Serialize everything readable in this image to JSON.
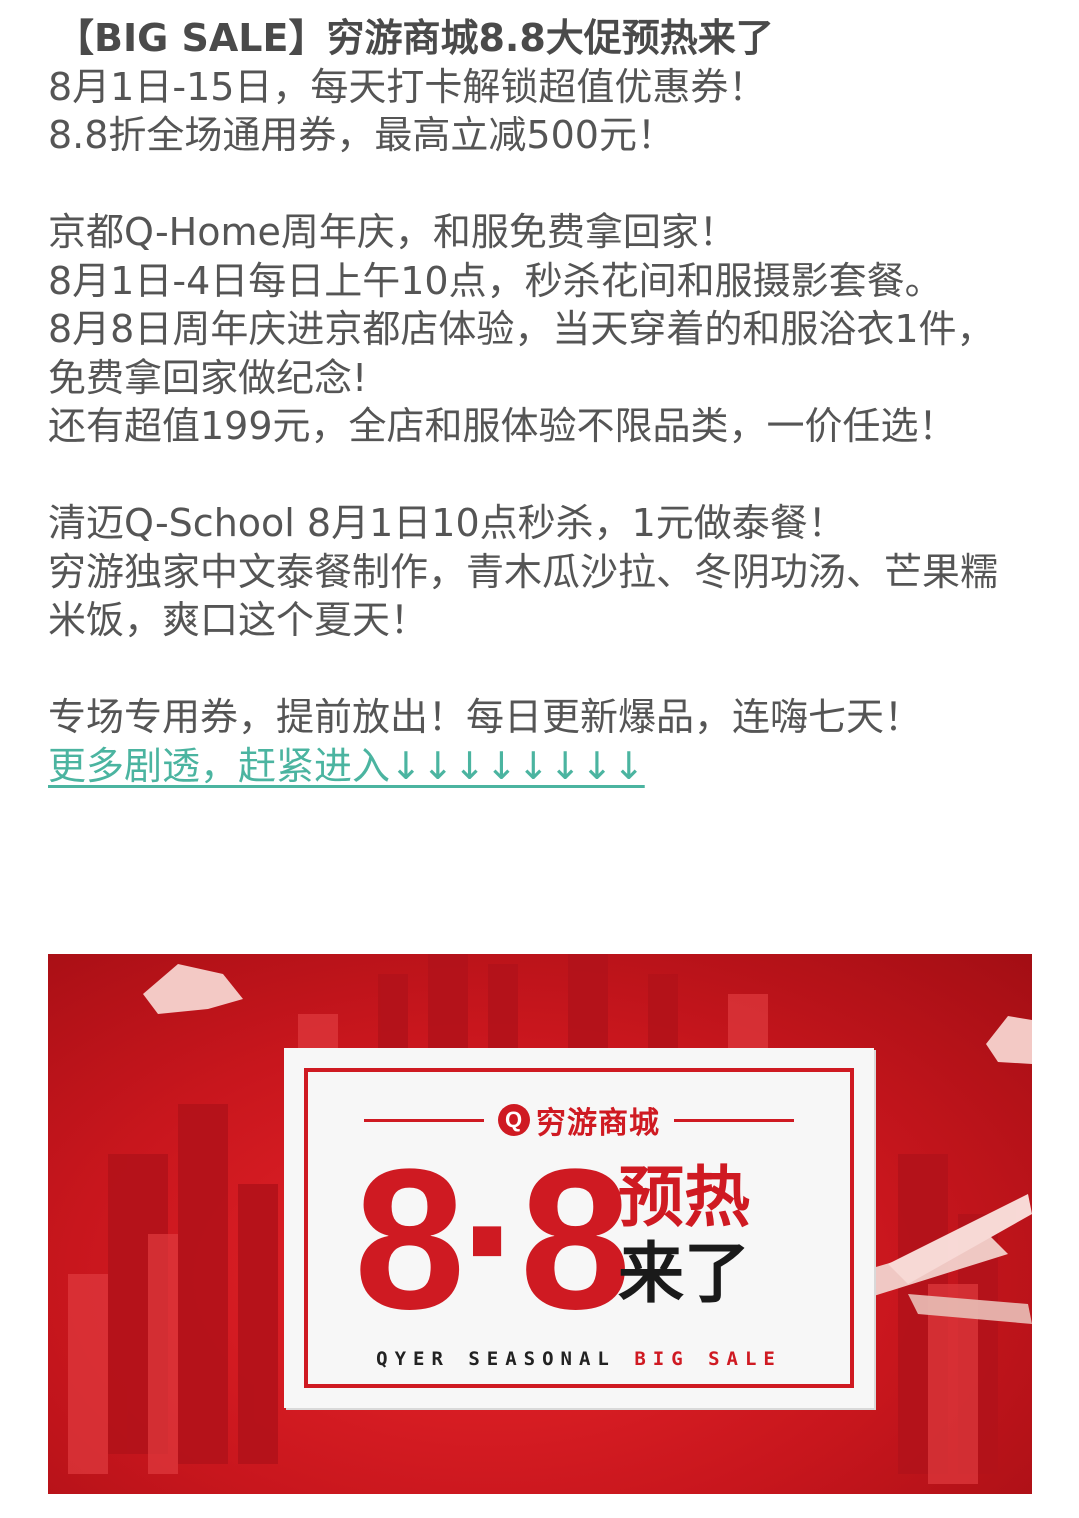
{
  "article": {
    "title": "【BIG SALE】穷游商城8.8大促预热来了",
    "intro": [
      "8月1日-15日，每天打卡解锁超值优惠券！",
      "8.8折全场通用券，最高立减500元！"
    ],
    "kyoto": [
      "京都Q-Home周年庆，和服免费拿回家！",
      "8月1日-4日每日上午10点，秒杀花间和服摄影套餐。",
      "8月8日周年庆进京都店体验，当天穿着的和服浴衣1件，免费拿回家做纪念!",
      "还有超值199元，全店和服体验不限品类，一价任选！"
    ],
    "chiangmai": [
      "清迈Q-School 8月1日10点秒杀，1元做泰餐！",
      "穷游独家中文泰餐制作，青木瓜沙拉、冬阴功汤、芒果糯米饭，爽口这个夏天！"
    ],
    "closing": "专场专用券，提前放出！每日更新爆品，连嗨七天！",
    "more_link": "更多剧透，赶紧进入↓↓↓↓↓↓↓↓"
  },
  "banner": {
    "brand_icon": "Q",
    "brand_name": "穷游商城",
    "big_number": "8·8",
    "hot_line1": "预热",
    "hot_line2": "来了",
    "tagline_dark": "QYER SEASONAL",
    "tagline_red": "BIG SALE",
    "colors": {
      "red": "#cf1a22",
      "link": "#4bb4a0"
    }
  }
}
